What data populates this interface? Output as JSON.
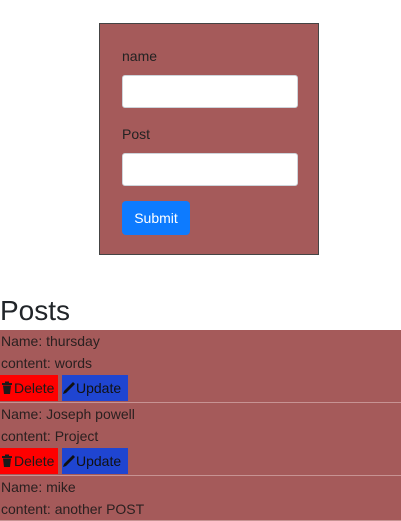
{
  "form": {
    "name_label": "name",
    "name_value": "",
    "post_label": "Post",
    "post_value": "",
    "submit_label": "Submit"
  },
  "posts_section": {
    "heading": "Posts",
    "delete_label": "Delete",
    "update_label": "Update",
    "items": [
      {
        "name": "Name: thursday",
        "content": "content: words"
      },
      {
        "name": "Name: Joseph powell",
        "content": "content: Project"
      },
      {
        "name": "Name: mike",
        "content": "content: another POST"
      }
    ]
  },
  "colors": {
    "card_bg": "#a55a5a",
    "submit_bg": "#0d7bff",
    "delete_bg": "#ff0000",
    "update_bg": "#1f45d1"
  },
  "icons": {
    "delete": "trash-icon",
    "update": "pencil-icon"
  }
}
